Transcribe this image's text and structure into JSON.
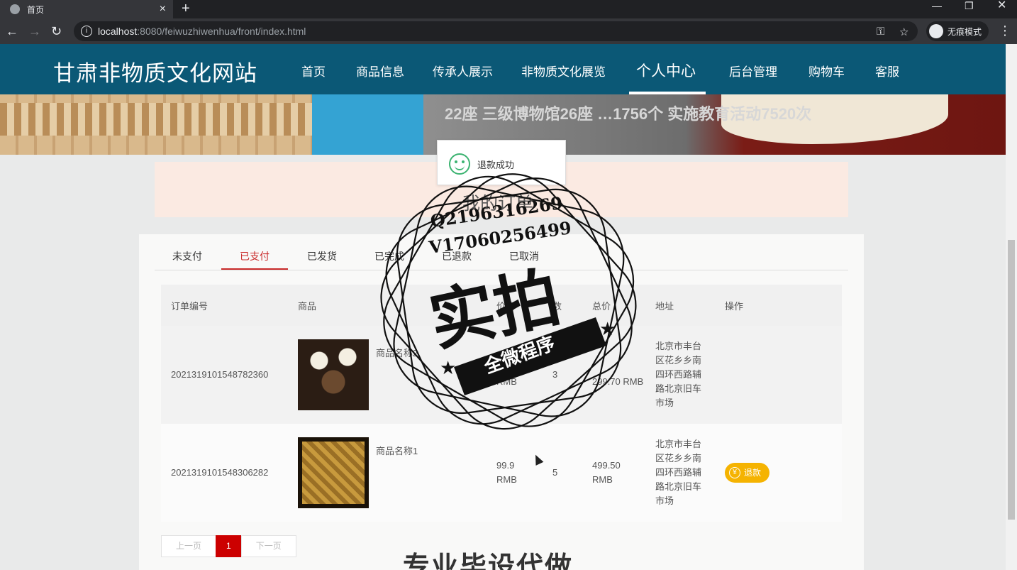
{
  "browser": {
    "tab_title": "首页",
    "url_host": "localhost",
    "url_rest": ":8080/feiwuzhiwenhua/front/index.html",
    "incognito_label": "无痕模式"
  },
  "site": {
    "title": "甘肃非物质文化网站",
    "nav": [
      "首页",
      "商品信息",
      "传承人展示",
      "非物质文化展览",
      "个人中心",
      "后台管理",
      "购物车",
      "客服"
    ]
  },
  "banner": {
    "text": "22座 三级博物馆26座 …1756个 实施教育活动7520次"
  },
  "toast": {
    "message": "退款成功"
  },
  "orders": {
    "title": "我的订单",
    "tabs": [
      "未支付",
      "已支付",
      "已发货",
      "已完成",
      "已退款",
      "已取消"
    ],
    "active_tab": "已支付",
    "columns": [
      "订单编号",
      "商品",
      "价格",
      "数",
      "总价",
      "地址",
      "操作"
    ],
    "rows": [
      {
        "id": "2021319101548782360",
        "product": "商品名称2",
        "price": "RMB",
        "qty": "3",
        "total": "299.70 RMB",
        "address": "北京市丰台区花乡乡南四环西路辅路北京旧车市场",
        "action": ""
      },
      {
        "id": "2021319101548306282",
        "product": "商品名称1",
        "price": "99.9 RMB",
        "qty": "5",
        "total": "499.50 RMB",
        "address": "北京市丰台区花乡乡南四环西路辅路北京旧车市场",
        "action": "退款"
      }
    ],
    "pager": {
      "prev": "上一页",
      "current": "1",
      "next": "下一页"
    }
  },
  "watermark": {
    "line1": "Q2196316269",
    "line2": "V17060256499",
    "big": "实拍",
    "ribbon": "全微程序",
    "bottom": "专业毕设代做"
  }
}
